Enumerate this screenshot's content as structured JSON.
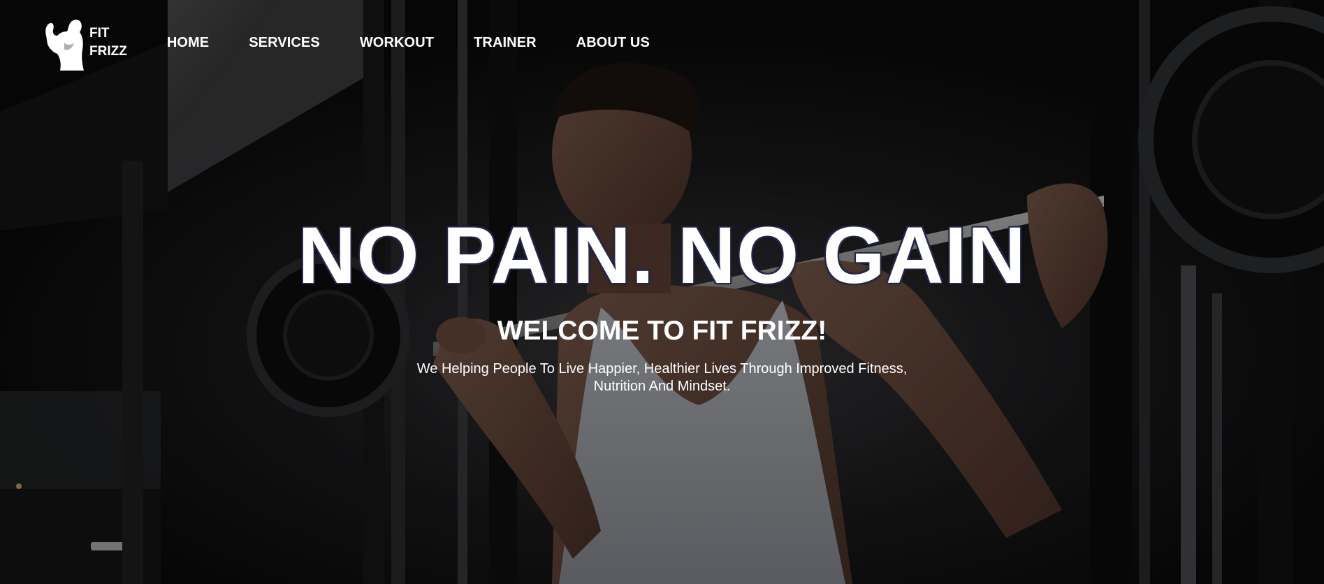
{
  "brand": {
    "logo_icon": "flexing-bodybuilder-icon",
    "name_line1": "FIT",
    "name_line2": "FRIZZ"
  },
  "nav": {
    "items": [
      {
        "label": "HOME"
      },
      {
        "label": "SERVICES"
      },
      {
        "label": "WORKOUT"
      },
      {
        "label": "TRAINER"
      },
      {
        "label": "ABOUT US"
      }
    ]
  },
  "hero": {
    "headline": "NO PAIN. NO GAIN",
    "subhead": "WELCOME TO FIT FRIZZ!",
    "tagline": "We Helping People To Live Happier, Healthier Lives Through Improved Fitness, Nutrition And Mindset.",
    "background_image": "man-lifting-barbell-squat-rack-photo"
  },
  "colors": {
    "background": "#0d0d0e",
    "text": "#ffffff",
    "headline_outline": "#23264a"
  }
}
